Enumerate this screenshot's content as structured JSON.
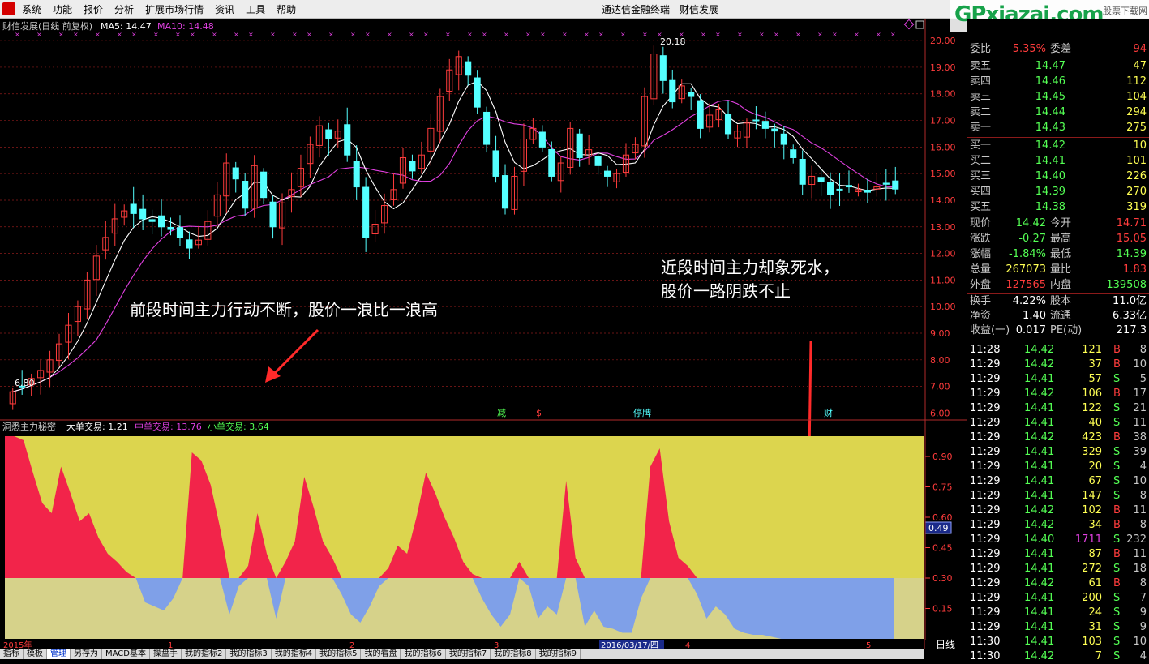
{
  "menubar": {
    "items": [
      "系统",
      "功能",
      "报价",
      "分析",
      "扩展市场行情",
      "资讯",
      "工具",
      "帮助"
    ],
    "title": "通达信金融终端　财信发展"
  },
  "watermark": {
    "main": "GPxiazai.com",
    "sub": "股票下载网"
  },
  "chart_header": {
    "name": "财信发展(日线 前复权)",
    "ma5": "MA5: 14.47",
    "ma10": "MA10: 14.48"
  },
  "annotations": {
    "left": "前段时间主力行动不断，股价一浪比一浪高",
    "right_line1": "近段时间主力却象死水，",
    "right_line2": "股价一路阴跌不止",
    "high": "20.18",
    "low": "6.80"
  },
  "event_markers": [
    "减",
    "$",
    "停牌",
    "财"
  ],
  "indicator_header": {
    "name": "洞悉主力秘密",
    "big": "大单交易: 1.21",
    "mid": "中单交易: 13.76",
    "small": "小单交易: 3.64",
    "current": "0.49"
  },
  "date_axis": {
    "labels": [
      "2015年",
      "1",
      "2",
      "3",
      "2016/03/17/四",
      "4",
      "5"
    ]
  },
  "bottom_tabs": [
    "指标",
    "模板",
    "管理",
    "另存为",
    "MACD基本",
    "操盘手",
    "我的指标2",
    "我的指标3",
    "我的指标4",
    "我的指标5",
    "我的看盘",
    "我的指标6",
    "我的指标7",
    "我的指标8",
    "我的指标9"
  ],
  "period_label": "日线",
  "colors": {
    "up": "#ff3c3c",
    "down": "#54ffff",
    "ma5": "#ffffff",
    "ma10": "#e040e0",
    "bg": "#000000",
    "grid": "#8b1a1a",
    "fill_red": "#f2244a",
    "fill_blue": "#7fa0e8",
    "fill_yellow": "#dcd54e",
    "fill_tan": "#d6d28a"
  },
  "chart_data": {
    "type": "candlestick",
    "ylim": [
      5.8,
      20.4
    ],
    "yticks": [
      6.0,
      7.0,
      8.0,
      9.0,
      10.0,
      11.0,
      12.0,
      13.0,
      14.0,
      15.0,
      16.0,
      17.0,
      18.0,
      19.0,
      20.0
    ],
    "close": [
      6.8,
      7.0,
      7.3,
      7.6,
      8.0,
      8.6,
      9.3,
      10.0,
      11.0,
      11.9,
      12.6,
      13.3,
      13.6,
      13.5,
      13.3,
      13.2,
      13.0,
      12.9,
      12.6,
      12.2,
      12.5,
      13.2,
      14.2,
      15.4,
      14.8,
      13.7,
      15.3,
      14.1,
      13.0,
      13.9,
      14.4,
      15.2,
      16.1,
      16.8,
      16.3,
      16.6,
      15.7,
      14.5,
      12.6,
      13.1,
      13.8,
      14.4,
      15.6,
      15.1,
      15.7,
      16.7,
      17.9,
      18.9,
      19.4,
      18.7,
      17.5,
      16.1,
      14.9,
      13.7,
      14.9,
      16.3,
      16.7,
      16.0,
      14.9,
      15.4,
      16.7,
      15.6,
      15.9,
      15.3,
      14.9,
      15.0,
      15.7,
      16.1,
      17.9,
      19.5,
      18.5,
      17.7,
      18.3,
      17.9,
      16.7,
      17.2,
      17.4,
      16.5,
      16.6,
      16.9,
      17.0,
      16.7,
      16.6,
      16.1,
      15.6,
      14.6,
      14.9,
      14.7,
      14.2,
      14.4,
      14.5,
      14.4,
      14.3,
      14.5,
      14.6,
      14.42
    ],
    "indicator": {
      "ylim": [
        0.0,
        1.0
      ],
      "yticks": [
        0.15,
        0.3,
        0.45,
        0.6,
        0.75,
        0.9
      ],
      "baseline": 0.3,
      "values": [
        1.02,
        1.05,
        0.98,
        0.82,
        0.67,
        0.62,
        0.85,
        0.72,
        0.58,
        0.62,
        0.5,
        0.42,
        0.38,
        0.33,
        0.3,
        0.18,
        0.16,
        0.14,
        0.2,
        0.3,
        0.92,
        0.88,
        0.76,
        0.55,
        0.12,
        0.26,
        0.36,
        0.62,
        0.42,
        0.1,
        0.38,
        0.48,
        0.8,
        0.65,
        0.48,
        0.4,
        0.22,
        0.12,
        0.08,
        0.16,
        0.26,
        0.35,
        0.46,
        0.42,
        0.6,
        0.82,
        0.72,
        0.6,
        0.5,
        0.38,
        0.32,
        0.2,
        0.12,
        0.06,
        0.12,
        0.38,
        0.26,
        0.1,
        0.16,
        0.12,
        0.78,
        0.4,
        0.06,
        0.14,
        0.06,
        0.05,
        0.03,
        0.03,
        0.2,
        0.85,
        0.94,
        0.58,
        0.4,
        0.36,
        0.22,
        0.1,
        0.16,
        0.12,
        0.05,
        0.03,
        0.02,
        0.02,
        0.01,
        0.0,
        0.0,
        0.0,
        0.0,
        0.0,
        0.0,
        0.0,
        0.0,
        0.0,
        0.0,
        0.0,
        0.0,
        0.0
      ]
    }
  },
  "quote": {
    "weibi_label": "委比",
    "weibi_value": "5.35%",
    "weicha_label": "委差",
    "weicha_value": "94",
    "sells": [
      {
        "label": "卖五",
        "price": "14.47",
        "vol": "47"
      },
      {
        "label": "卖四",
        "price": "14.46",
        "vol": "112"
      },
      {
        "label": "卖三",
        "price": "14.45",
        "vol": "104"
      },
      {
        "label": "卖二",
        "price": "14.44",
        "vol": "294"
      },
      {
        "label": "卖一",
        "price": "14.43",
        "vol": "275"
      }
    ],
    "buys": [
      {
        "label": "买一",
        "price": "14.42",
        "vol": "10"
      },
      {
        "label": "买二",
        "price": "14.41",
        "vol": "101"
      },
      {
        "label": "买三",
        "price": "14.40",
        "vol": "226"
      },
      {
        "label": "买四",
        "price": "14.39",
        "vol": "270"
      },
      {
        "label": "买五",
        "price": "14.38",
        "vol": "319"
      }
    ],
    "stats": [
      {
        "l1": "现价",
        "v1": "14.42",
        "l2": "今开",
        "v2": "14.71",
        "c1": "#54ff54",
        "c2": "#ff3c3c"
      },
      {
        "l1": "涨跌",
        "v1": "-0.27",
        "l2": "最高",
        "v2": "15.05",
        "c1": "#54ff54",
        "c2": "#ff3c3c"
      },
      {
        "l1": "涨幅",
        "v1": "-1.84%",
        "l2": "最低",
        "v2": "14.39",
        "c1": "#54ff54",
        "c2": "#54ff54"
      },
      {
        "l1": "总量",
        "v1": "267073",
        "l2": "量比",
        "v2": "1.83",
        "c1": "#ffff54",
        "c2": "#ff3c3c"
      },
      {
        "l1": "外盘",
        "v1": "127565",
        "l2": "内盘",
        "v2": "139508",
        "c1": "#ff3c3c",
        "c2": "#54ff54"
      }
    ],
    "stats2": [
      {
        "l1": "换手",
        "v1": "4.22%",
        "l2": "股本",
        "v2": "11.0亿"
      },
      {
        "l1": "净资",
        "v1": "1.40",
        "l2": "流通",
        "v2": "6.33亿"
      },
      {
        "l1": "收益(一)",
        "v1": "0.017",
        "l2": "PE(动)",
        "v2": "217.3"
      }
    ],
    "ticks": [
      {
        "t": "11:28",
        "p": "14.42",
        "v": "121",
        "s": "B",
        "n": "8"
      },
      {
        "t": "11:29",
        "p": "14.42",
        "v": "37",
        "s": "B",
        "n": "10"
      },
      {
        "t": "11:29",
        "p": "14.41",
        "v": "57",
        "s": "S",
        "n": "5"
      },
      {
        "t": "11:29",
        "p": "14.42",
        "v": "106",
        "s": "B",
        "n": "17"
      },
      {
        "t": "11:29",
        "p": "14.41",
        "v": "122",
        "s": "S",
        "n": "21"
      },
      {
        "t": "11:29",
        "p": "14.41",
        "v": "40",
        "s": "S",
        "n": "11"
      },
      {
        "t": "11:29",
        "p": "14.42",
        "v": "423",
        "s": "B",
        "n": "38"
      },
      {
        "t": "11:29",
        "p": "14.41",
        "v": "329",
        "s": "S",
        "n": "39"
      },
      {
        "t": "11:29",
        "p": "14.41",
        "v": "20",
        "s": "S",
        "n": "4"
      },
      {
        "t": "11:29",
        "p": "14.41",
        "v": "67",
        "s": "S",
        "n": "10"
      },
      {
        "t": "11:29",
        "p": "14.41",
        "v": "147",
        "s": "S",
        "n": "8"
      },
      {
        "t": "11:29",
        "p": "14.42",
        "v": "102",
        "s": "B",
        "n": "11"
      },
      {
        "t": "11:29",
        "p": "14.42",
        "v": "34",
        "s": "B",
        "n": "8"
      },
      {
        "t": "11:29",
        "p": "14.40",
        "v": "1711",
        "s": "S",
        "n": "232"
      },
      {
        "t": "11:29",
        "p": "14.41",
        "v": "87",
        "s": "B",
        "n": "11"
      },
      {
        "t": "11:29",
        "p": "14.41",
        "v": "272",
        "s": "S",
        "n": "18"
      },
      {
        "t": "11:29",
        "p": "14.42",
        "v": "61",
        "s": "B",
        "n": "8"
      },
      {
        "t": "11:29",
        "p": "14.41",
        "v": "200",
        "s": "S",
        "n": "7"
      },
      {
        "t": "11:29",
        "p": "14.41",
        "v": "24",
        "s": "S",
        "n": "9"
      },
      {
        "t": "11:29",
        "p": "14.41",
        "v": "31",
        "s": "S",
        "n": "9"
      },
      {
        "t": "11:30",
        "p": "14.41",
        "v": "103",
        "s": "S",
        "n": "10"
      },
      {
        "t": "11:30",
        "p": "14.42",
        "v": "7",
        "s": "S",
        "n": "4"
      }
    ]
  }
}
